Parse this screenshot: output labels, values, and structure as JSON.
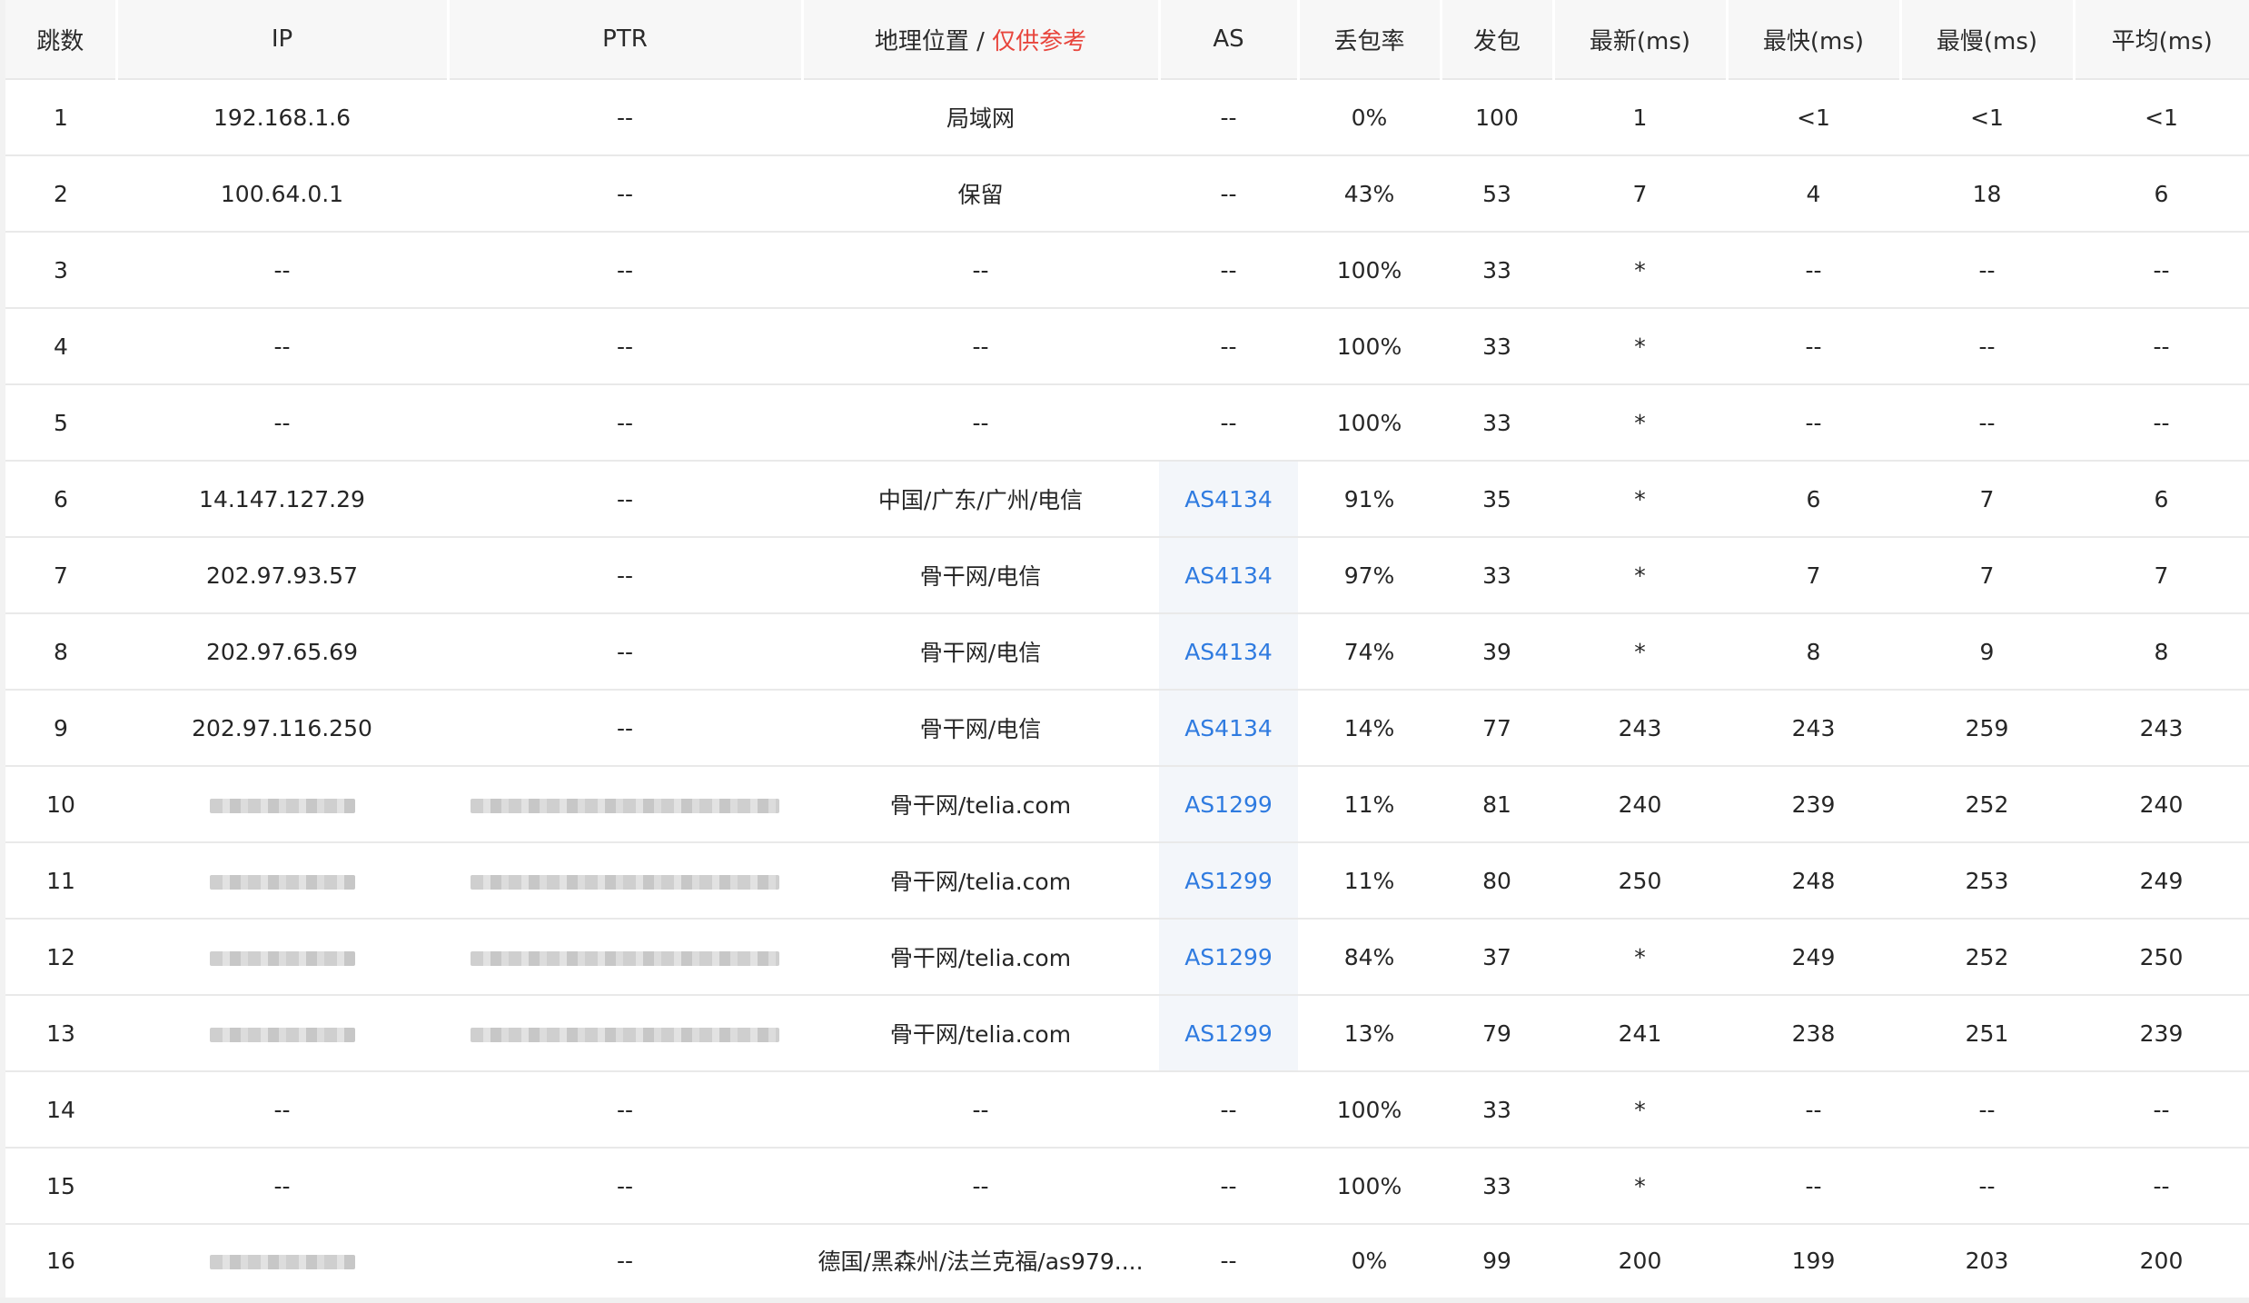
{
  "header": {
    "hop": "跳数",
    "ip": "IP",
    "ptr": "PTR",
    "geo_label": "地理位置",
    "geo_sep": " / ",
    "geo_hint": "仅供参考",
    "as": "AS",
    "loss": "丢包率",
    "sent": "发包",
    "last": "最新(ms)",
    "best": "最快(ms)",
    "worst": "最慢(ms)",
    "avg": "平均(ms)"
  },
  "accent_colors": {
    "hint": "#e8453c",
    "as_link": "#2f7be0"
  },
  "rows": [
    {
      "hop": "1",
      "ip": "192.168.1.6",
      "ip_masked": false,
      "ptr": "--",
      "ptr_masked": false,
      "geo": "局域网",
      "as": "--",
      "as_link": false,
      "loss": "0%",
      "sent": "100",
      "last": "1",
      "best": "<1",
      "worst": "<1",
      "avg": "<1"
    },
    {
      "hop": "2",
      "ip": "100.64.0.1",
      "ip_masked": false,
      "ptr": "--",
      "ptr_masked": false,
      "geo": "保留",
      "as": "--",
      "as_link": false,
      "loss": "43%",
      "sent": "53",
      "last": "7",
      "best": "4",
      "worst": "18",
      "avg": "6"
    },
    {
      "hop": "3",
      "ip": "--",
      "ip_masked": false,
      "ptr": "--",
      "ptr_masked": false,
      "geo": "--",
      "as": "--",
      "as_link": false,
      "loss": "100%",
      "sent": "33",
      "last": "*",
      "best": "--",
      "worst": "--",
      "avg": "--"
    },
    {
      "hop": "4",
      "ip": "--",
      "ip_masked": false,
      "ptr": "--",
      "ptr_masked": false,
      "geo": "--",
      "as": "--",
      "as_link": false,
      "loss": "100%",
      "sent": "33",
      "last": "*",
      "best": "--",
      "worst": "--",
      "avg": "--"
    },
    {
      "hop": "5",
      "ip": "--",
      "ip_masked": false,
      "ptr": "--",
      "ptr_masked": false,
      "geo": "--",
      "as": "--",
      "as_link": false,
      "loss": "100%",
      "sent": "33",
      "last": "*",
      "best": "--",
      "worst": "--",
      "avg": "--"
    },
    {
      "hop": "6",
      "ip": "14.147.127.29",
      "ip_masked": false,
      "ptr": "--",
      "ptr_masked": false,
      "geo": "中国/广东/广州/电信",
      "as": "AS4134",
      "as_link": true,
      "loss": "91%",
      "sent": "35",
      "last": "*",
      "best": "6",
      "worst": "7",
      "avg": "6"
    },
    {
      "hop": "7",
      "ip": "202.97.93.57",
      "ip_masked": false,
      "ptr": "--",
      "ptr_masked": false,
      "geo": "骨干网/电信",
      "as": "AS4134",
      "as_link": true,
      "loss": "97%",
      "sent": "33",
      "last": "*",
      "best": "7",
      "worst": "7",
      "avg": "7"
    },
    {
      "hop": "8",
      "ip": "202.97.65.69",
      "ip_masked": false,
      "ptr": "--",
      "ptr_masked": false,
      "geo": "骨干网/电信",
      "as": "AS4134",
      "as_link": true,
      "loss": "74%",
      "sent": "39",
      "last": "*",
      "best": "8",
      "worst": "9",
      "avg": "8"
    },
    {
      "hop": "9",
      "ip": "202.97.116.250",
      "ip_masked": false,
      "ptr": "--",
      "ptr_masked": false,
      "geo": "骨干网/电信",
      "as": "AS4134",
      "as_link": true,
      "loss": "14%",
      "sent": "77",
      "last": "243",
      "best": "243",
      "worst": "259",
      "avg": "243"
    },
    {
      "hop": "10",
      "ip": "",
      "ip_masked": true,
      "ptr": "",
      "ptr_masked": true,
      "geo": "骨干网/telia.com",
      "as": "AS1299",
      "as_link": true,
      "loss": "11%",
      "sent": "81",
      "last": "240",
      "best": "239",
      "worst": "252",
      "avg": "240"
    },
    {
      "hop": "11",
      "ip": "",
      "ip_masked": true,
      "ptr": "",
      "ptr_masked": true,
      "geo": "骨干网/telia.com",
      "as": "AS1299",
      "as_link": true,
      "loss": "11%",
      "sent": "80",
      "last": "250",
      "best": "248",
      "worst": "253",
      "avg": "249"
    },
    {
      "hop": "12",
      "ip": "",
      "ip_masked": true,
      "ptr": "",
      "ptr_masked": true,
      "geo": "骨干网/telia.com",
      "as": "AS1299",
      "as_link": true,
      "loss": "84%",
      "sent": "37",
      "last": "*",
      "best": "249",
      "worst": "252",
      "avg": "250"
    },
    {
      "hop": "13",
      "ip": "",
      "ip_masked": true,
      "ptr": "",
      "ptr_masked": true,
      "geo": "骨干网/telia.com",
      "as": "AS1299",
      "as_link": true,
      "loss": "13%",
      "sent": "79",
      "last": "241",
      "best": "238",
      "worst": "251",
      "avg": "239"
    },
    {
      "hop": "14",
      "ip": "--",
      "ip_masked": false,
      "ptr": "--",
      "ptr_masked": false,
      "geo": "--",
      "as": "--",
      "as_link": false,
      "loss": "100%",
      "sent": "33",
      "last": "*",
      "best": "--",
      "worst": "--",
      "avg": "--"
    },
    {
      "hop": "15",
      "ip": "--",
      "ip_masked": false,
      "ptr": "--",
      "ptr_masked": false,
      "geo": "--",
      "as": "--",
      "as_link": false,
      "loss": "100%",
      "sent": "33",
      "last": "*",
      "best": "--",
      "worst": "--",
      "avg": "--"
    },
    {
      "hop": "16",
      "ip": "",
      "ip_masked": true,
      "ptr": "--",
      "ptr_masked": false,
      "geo": "德国/黑森州/法兰克福/as979....",
      "as": "--",
      "as_link": false,
      "loss": "0%",
      "sent": "99",
      "last": "200",
      "best": "199",
      "worst": "203",
      "avg": "200"
    }
  ]
}
